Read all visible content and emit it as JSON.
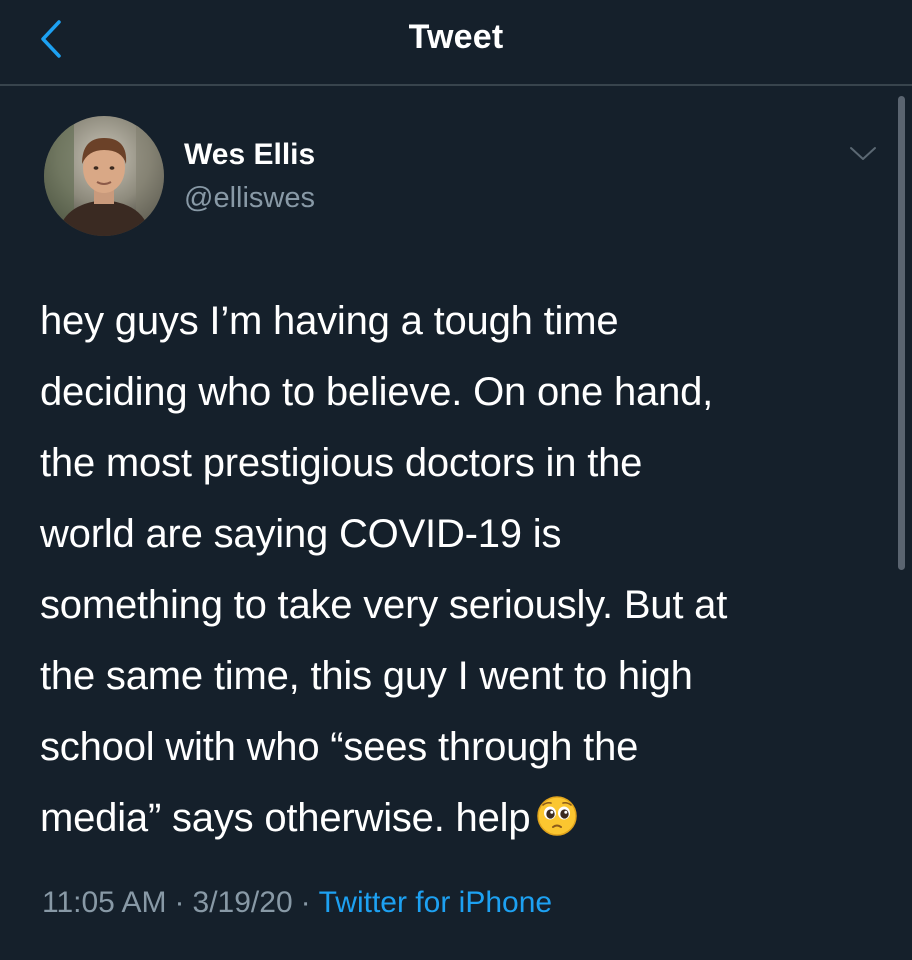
{
  "header": {
    "title": "Tweet",
    "back_icon": "chevron-left-icon"
  },
  "author": {
    "name": "Wes Ellis",
    "handle": "@elliswes",
    "menu_icon": "chevron-down-icon"
  },
  "tweet": {
    "text": "hey guys I’m having a tough time\ndeciding who to believe. On one hand,\nthe most prestigious doctors in the\nworld are saying COVID-19 is\nsomething to take very seriously. But at\nthe same time, this guy I went to high\nschool with who “sees through the\nmedia” says otherwise. help",
    "emoji": "pleading-face-emoji"
  },
  "meta": {
    "time": "11:05 AM",
    "separator": "·",
    "date": "3/19/20",
    "source": "Twitter for iPhone"
  },
  "colors": {
    "background": "#15202b",
    "accent": "#1da1f2",
    "secondary_text": "#8899a6",
    "divider": "#38444d"
  }
}
